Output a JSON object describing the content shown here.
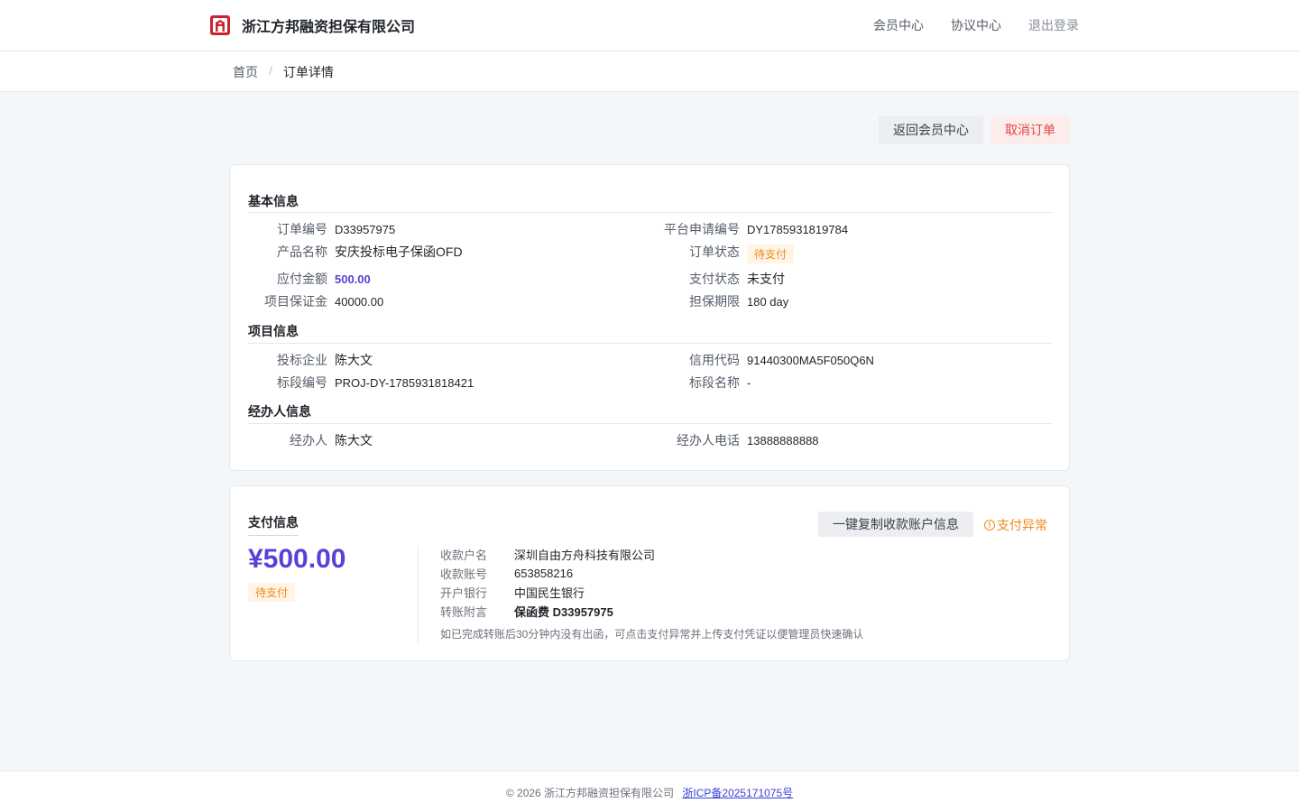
{
  "header": {
    "brand_name": "浙江方邦融资担保有限公司",
    "nav": [
      "会员中心",
      "协议中心",
      "退出登录"
    ]
  },
  "breadcrumb": {
    "home": "首页",
    "separator": "/",
    "current": "订单详情"
  },
  "actions": {
    "back_label": "返回会员中心",
    "cancel_label": "取消订单"
  },
  "basic": {
    "title": "基本信息",
    "order_no_label": "订单编号",
    "order_no": "D33957975",
    "platform_no_label": "平台申请编号",
    "platform_no": "DY1785931819784",
    "product_label": "产品名称",
    "product": "安庆投标电子保函OFD",
    "order_status_label": "订单状态",
    "order_status": "待支付",
    "amount_label": "应付金额",
    "amount": "500.00",
    "pay_status_label": "支付状态",
    "pay_status": "未支付",
    "deposit_label": "项目保证金",
    "deposit": "40000.00",
    "period_label": "担保期限",
    "period": "180 day"
  },
  "project": {
    "title": "项目信息",
    "bidder_label": "投标企业",
    "bidder": "陈大文",
    "credit_label": "信用代码",
    "credit": "91440300MA5F050Q6N",
    "section_no_label": "标段编号",
    "section_no": "PROJ-DY-1785931818421",
    "section_name_label": "标段名称",
    "section_name": "-"
  },
  "agent": {
    "title": "经办人信息",
    "name_label": "经办人",
    "name": "陈大文",
    "phone_label": "经办人电话",
    "phone": "13888888888"
  },
  "payment": {
    "title": "支付信息",
    "copy_label": "一键复制收款账户信息",
    "abnormal_label": "支付异常",
    "amount": "¥500.00",
    "status": "待支付",
    "payee_label": "收款户名",
    "payee": "深圳自由方舟科技有限公司",
    "account_label": "收款账号",
    "account": "653858216",
    "bank_label": "开户银行",
    "bank": "中国民生银行",
    "memo_label": "转账附言",
    "memo": "保函费 D33957975",
    "note": "如已完成转账后30分钟内没有出函，可点击支付异常并上传支付凭证以便管理员快速确认"
  },
  "footer": {
    "copyright": "© 2026 浙江方邦融资担保有限公司",
    "icp": "浙ICP备2025171075号"
  },
  "colors": {
    "accent": "#5b3fd8",
    "warning": "#f08a1a",
    "danger": "#e34545",
    "logo": "#c8242f"
  }
}
